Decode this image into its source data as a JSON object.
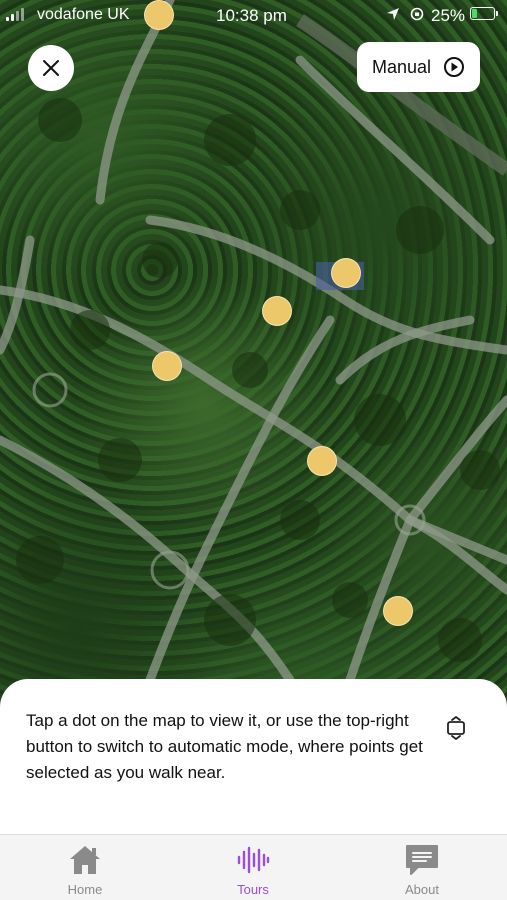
{
  "status_bar": {
    "carrier": "vodafone UK",
    "time": "10:38 pm",
    "battery_percent": "25%",
    "battery_level": 0.25
  },
  "map": {
    "dot_color": "#ecc86a",
    "dots_count": 6
  },
  "top_controls": {
    "close_icon": "close-icon",
    "mode_label": "Manual",
    "mode_icon": "play-circle-icon"
  },
  "info_sheet": {
    "message": "Tap a dot on the map to view it, or use the top-right button to switch to automatic mode, where points get selected as you walk near.",
    "recenter_icon": "recenter-icon"
  },
  "tab_bar": {
    "accent": "#9b4ed6",
    "tabs": [
      {
        "label": "Home",
        "icon": "home-icon"
      },
      {
        "label": "Tours",
        "icon": "audio-wave-icon"
      },
      {
        "label": "About",
        "icon": "chat-bubble-icon"
      }
    ]
  }
}
